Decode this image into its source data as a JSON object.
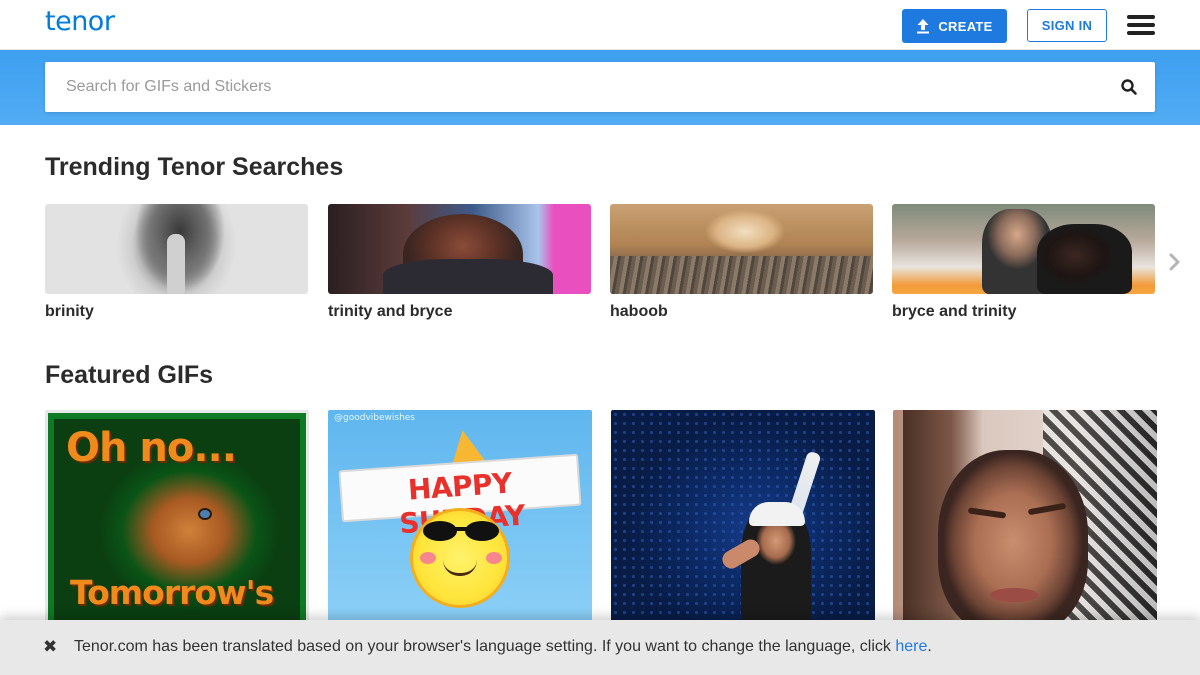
{
  "header": {
    "logo": "tenor",
    "create_label": "CREATE",
    "signin_label": "SIGN IN",
    "menu_icon": "hamburger-menu-icon",
    "upload_icon": "upload-arrow-icon"
  },
  "search": {
    "placeholder": "Search for GIFs and Stickers",
    "value": "",
    "icon": "magnifier-icon"
  },
  "trending": {
    "title": "Trending Tenor Searches",
    "items": [
      {
        "label": "brinity"
      },
      {
        "label": "trinity and bryce"
      },
      {
        "label": "haboob"
      },
      {
        "label": "bryce and trinity"
      }
    ],
    "next_icon": "chevron-right-icon"
  },
  "featured": {
    "title": "Featured GIFs",
    "items": [
      {
        "caption_top": "Oh no...",
        "caption_bottom": "Tomorrow's"
      },
      {
        "credit": "@goodvibewishes",
        "banner": "HAPPY SUNDAY"
      },
      {},
      {}
    ]
  },
  "notice": {
    "text": "Tenor.com has been translated based on your browser's language setting. If you want to change the language, click ",
    "link": "here",
    "suffix": ".",
    "close_icon": "close-x-icon"
  },
  "colors": {
    "brand_blue": "#1f7ae0",
    "logo_blue": "#007ddb",
    "search_band": "#3d9ff0",
    "notice_bg": "#e8e8e8"
  }
}
